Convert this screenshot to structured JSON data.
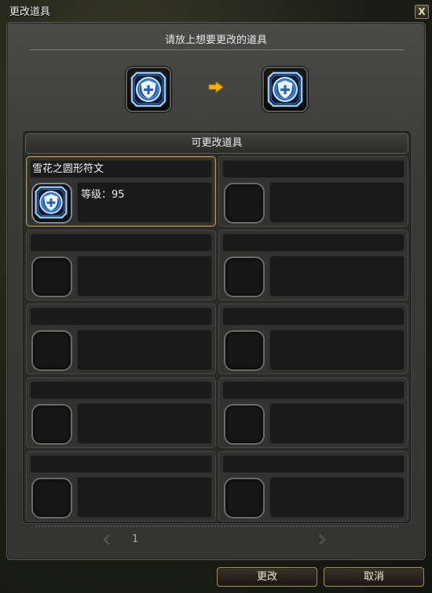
{
  "window": {
    "title": "更改道具",
    "close_label": "X"
  },
  "instruction": "请放上想要更改的道具",
  "list": {
    "header": "可更改道具",
    "items": [
      {
        "name": "雪花之圆形符文",
        "level_label": "等级：95"
      }
    ]
  },
  "pager": {
    "page": "1"
  },
  "buttons": {
    "change": "更改",
    "cancel": "取消"
  },
  "icons": {
    "rune": "rune-shield-icon",
    "arrow": "arrow-right-icon",
    "prev": "chevron-left-icon",
    "next": "chevron-right-icon"
  },
  "colors": {
    "accent_gold": "#f0b400",
    "selected_border": "#b89a55",
    "rune_blue": "#2f6fb8"
  }
}
